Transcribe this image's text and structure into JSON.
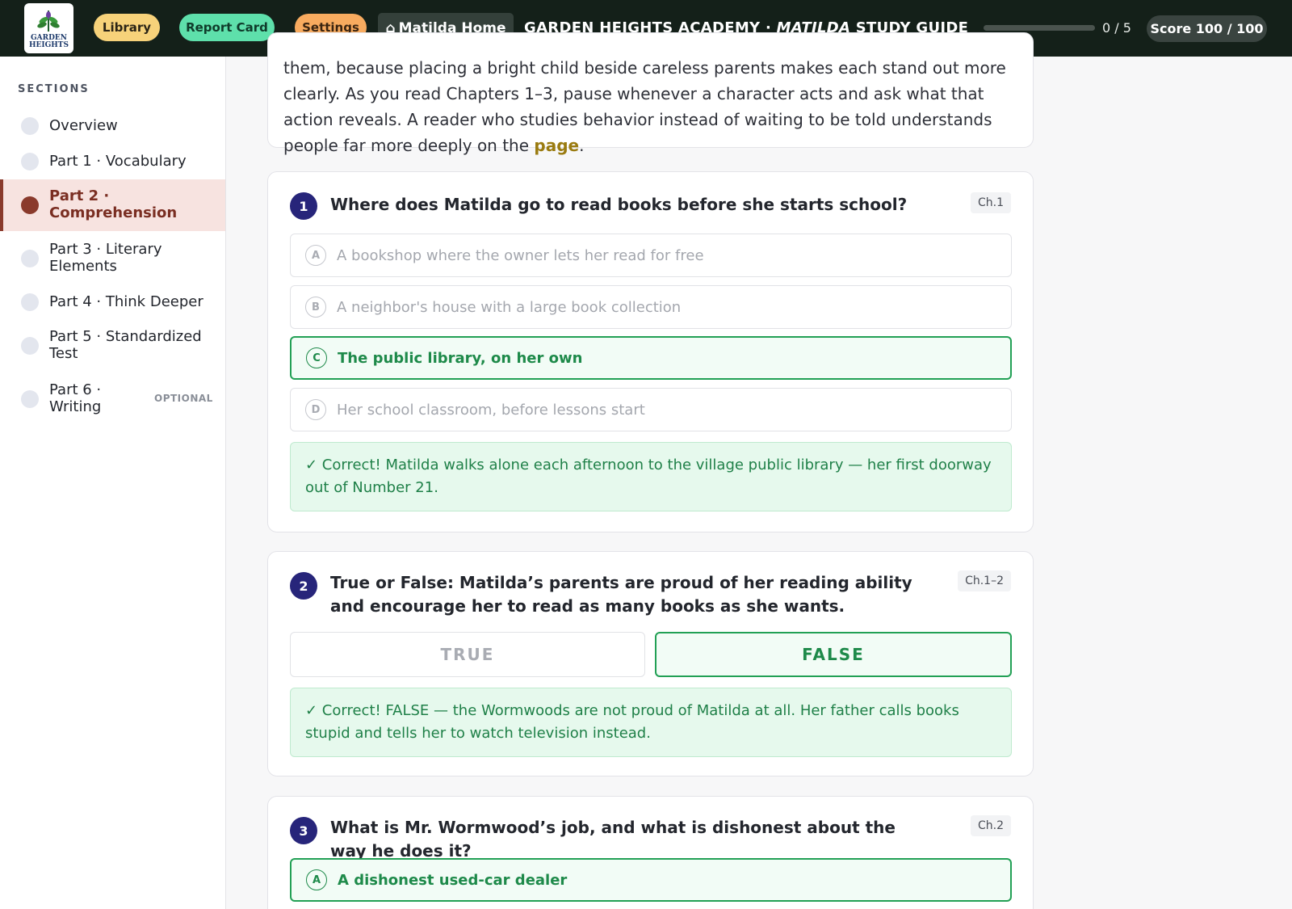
{
  "topbar": {
    "logo_text_line1": "GARDEN",
    "logo_text_line2": "HEIGHTS",
    "library_label": "Library",
    "report_card_label": "Report Card",
    "settings_label": "Settings",
    "home_icon": "⌂",
    "home_label": "Matilda Home",
    "title_prefix": "GARDEN HEIGHTS ACADEMY · ",
    "title_book": "MATILDA",
    "title_suffix": " STUDY GUIDE",
    "progress_text": "0 / 5",
    "progress_fraction": 0,
    "score_text": "Score 100 / 100"
  },
  "sidebar": {
    "heading": "SECTIONS",
    "items": [
      {
        "label": "Overview",
        "active": false
      },
      {
        "label": "Part 1 · Vocabulary",
        "active": false
      },
      {
        "label": "Part 2 · Comprehension",
        "active": true
      },
      {
        "label": "Part 3 · Literary Elements",
        "active": false
      },
      {
        "label": "Part 4 · Think Deeper",
        "active": false
      },
      {
        "label": "Part 5 · Standardized Test",
        "active": false
      },
      {
        "label": "Part 6 · Writing",
        "active": false,
        "badge": "OPTIONAL"
      }
    ]
  },
  "intro": {
    "text_before": "them, because placing a bright child beside careless parents makes each stand out more clearly. As you read Chapters 1–3, pause whenever a character acts and ask what that action reveals. A reader who studies behavior instead of waiting to be told understands people far more deeply on the ",
    "highlight": "page",
    "text_after": "."
  },
  "questions": [
    {
      "number": "1",
      "text": "Where does Matilda go to read books before she starts school?",
      "chapter": "Ch.1",
      "options": [
        {
          "letter": "A",
          "text": "A bookshop where the owner lets her read for free"
        },
        {
          "letter": "B",
          "text": "A neighbor's house with a large book collection"
        },
        {
          "letter": "C",
          "text": "The public library, on her own"
        },
        {
          "letter": "D",
          "text": "Her school classroom, before lessons start"
        }
      ],
      "feedback": "✓ Correct! Matilda walks alone each afternoon to the village public library — her first doorway out of Number 21."
    },
    {
      "number": "2",
      "text": "True or False: Matilda’s parents are proud of her reading ability and encourage her to read as many books as she wants.",
      "chapter": "Ch.1–2",
      "true_label": "TRUE",
      "false_label": "FALSE",
      "feedback": "✓ Correct! FALSE — the Wormwoods are not proud of Matilda at all. Her father calls books stupid and tells her to watch television instead."
    },
    {
      "number": "3",
      "text": "What is Mr. Wormwood’s job, and what is dishonest about the way he does it?",
      "chapter": "Ch.2",
      "options": [
        {
          "letter": "A",
          "text": "A dishonest used-car dealer"
        }
      ]
    }
  ]
}
